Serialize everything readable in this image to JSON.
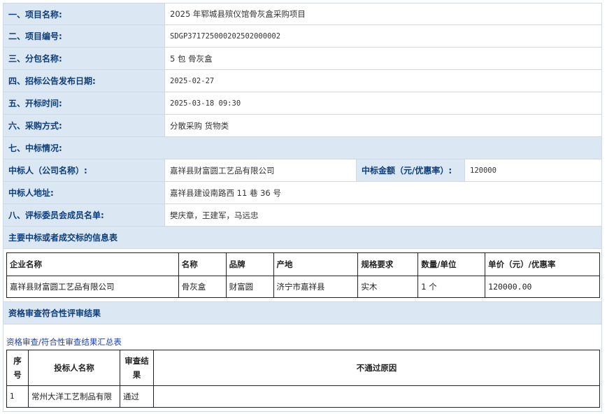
{
  "info_rows": [
    {
      "label": "一、项目名称:",
      "value": "2025 年郓城县殡仪馆骨灰盒采购项目"
    },
    {
      "label": "二、项目编号:",
      "value": "SDGP371725000202502000002"
    },
    {
      "label": "三、分包名称:",
      "value": "5 包  骨灰盒"
    },
    {
      "label": "四、招标公告发布日期:",
      "value": "2025-02-27"
    },
    {
      "label": "五、开标时间:",
      "value": "2025-03-18 09:30"
    },
    {
      "label": "六、采购方式:",
      "value": "分散采购  货物类"
    }
  ],
  "section7_label": "七、中标情况:",
  "winner": {
    "name_label": "中标人（公司名称）:",
    "name_value": "嘉祥县财富圆工艺品有限公司",
    "amount_label": "中标金额（元/优惠率）:",
    "amount_value": "120000",
    "address_label": "中标人地址:",
    "address_value": "嘉祥县建设南路西 11 巷 36 号"
  },
  "committee": {
    "label": "八、评标委员会成员名单:",
    "value": "樊庆章，王建军，马远忠"
  },
  "main_info_title": "主要中标或者成交标的信息表",
  "main_table": {
    "headers": [
      "企业名称",
      "名称",
      "品牌",
      "产地",
      "规格要求",
      "数量/单位",
      "单价（元）/优惠率"
    ],
    "row": [
      "嘉祥县财富圆工艺品有限公司",
      "骨灰盒",
      "财富圆",
      "济宁市嘉祥县",
      "实木",
      "1 个",
      "120000.00"
    ]
  },
  "qualification_title": "资格审查符合性评审结果",
  "summary_link": "资格审查/符合性审查结果汇总表",
  "review_table": {
    "headers": [
      "序号",
      "投标人名称",
      "审查结果",
      "不通过原因"
    ],
    "row": [
      "1",
      "常州大洋工艺制品有限",
      "通过",
      ""
    ]
  }
}
